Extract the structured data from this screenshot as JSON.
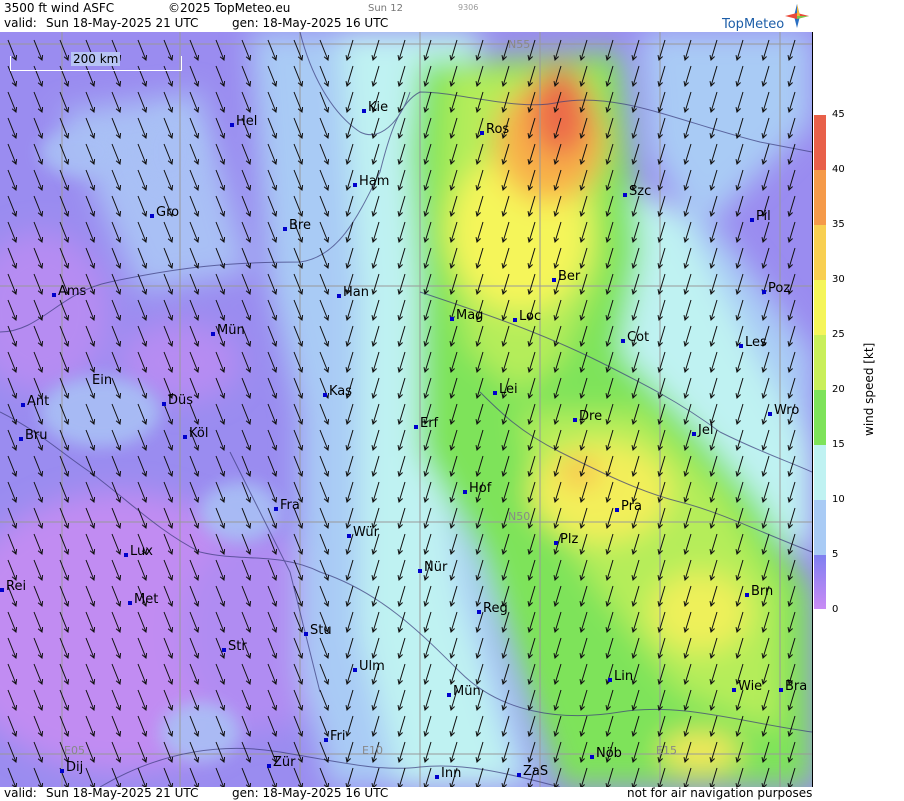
{
  "header": {
    "product": "3500 ft wind ASFC",
    "copyright": "©2025 TopMeteo.eu",
    "run_label": "Sun 12",
    "code": "9306",
    "valid_prefix": "valid:",
    "valid_time": "Sun  18-May-2025  21 UTC",
    "gen_time": "gen: 18-May-2025 16 UTC",
    "logo": "TopMeteo"
  },
  "footer": {
    "valid_prefix": "valid:",
    "valid_time": "Sun  18-May-2025  21 UTC",
    "gen_time": "gen: 18-May-2025 16 UTC",
    "disclaimer": "not for air navigation purposes"
  },
  "scale": {
    "label": "200 km"
  },
  "legend": {
    "title": "wind speed  [kt]",
    "ticks": [
      "45",
      "40",
      "35",
      "30",
      "25",
      "20",
      "15",
      "10",
      "5",
      "0"
    ],
    "colors": [
      "#e8604a",
      "#f59a4a",
      "#f8cf52",
      "#f5f55a",
      "#c9ef5a",
      "#7ee35a",
      "#bff2f2",
      "#a9cbf5",
      "#7f7ff0",
      "#c98cf5"
    ]
  },
  "grid_labels": {
    "n55": "N55",
    "n50": "N50",
    "e05": "E05",
    "e10": "E10",
    "e15": "E15"
  },
  "cities": [
    {
      "name": "Kie"
    },
    {
      "name": "Hel"
    },
    {
      "name": "Ros"
    },
    {
      "name": "Ham"
    },
    {
      "name": "Szc"
    },
    {
      "name": "Gro"
    },
    {
      "name": "Bre"
    },
    {
      "name": "Pil"
    },
    {
      "name": "Ber"
    },
    {
      "name": "Ams"
    },
    {
      "name": "Han"
    },
    {
      "name": "Poz"
    },
    {
      "name": "Mag"
    },
    {
      "name": "Loc"
    },
    {
      "name": "Mün"
    },
    {
      "name": "Cot"
    },
    {
      "name": "Les"
    },
    {
      "name": "Ein"
    },
    {
      "name": "Kas"
    },
    {
      "name": "Lei"
    },
    {
      "name": "Ant"
    },
    {
      "name": "Düs"
    },
    {
      "name": "Dre"
    },
    {
      "name": "Wro"
    },
    {
      "name": "Bru"
    },
    {
      "name": "Köl"
    },
    {
      "name": "Erf"
    },
    {
      "name": "Jel"
    },
    {
      "name": "Hof"
    },
    {
      "name": "Fra"
    },
    {
      "name": "Pra"
    },
    {
      "name": "Wür"
    },
    {
      "name": "Plz"
    },
    {
      "name": "Lux"
    },
    {
      "name": "Nür"
    },
    {
      "name": "Rei"
    },
    {
      "name": "Met"
    },
    {
      "name": "Reg"
    },
    {
      "name": "Brn"
    },
    {
      "name": "Stu"
    },
    {
      "name": "Str"
    },
    {
      "name": "Ulm"
    },
    {
      "name": "Lin"
    },
    {
      "name": "Wie"
    },
    {
      "name": "Bra"
    },
    {
      "name": "Mün"
    },
    {
      "name": "Fri"
    },
    {
      "name": "Nöb"
    },
    {
      "name": "Dij"
    },
    {
      "name": "Zür"
    },
    {
      "name": "Inn"
    },
    {
      "name": "ZaS"
    }
  ],
  "colors": {
    "city_marker": "#0000cc",
    "land_violet": "#9a8cf0",
    "land_blue": "#a9cbf5"
  }
}
